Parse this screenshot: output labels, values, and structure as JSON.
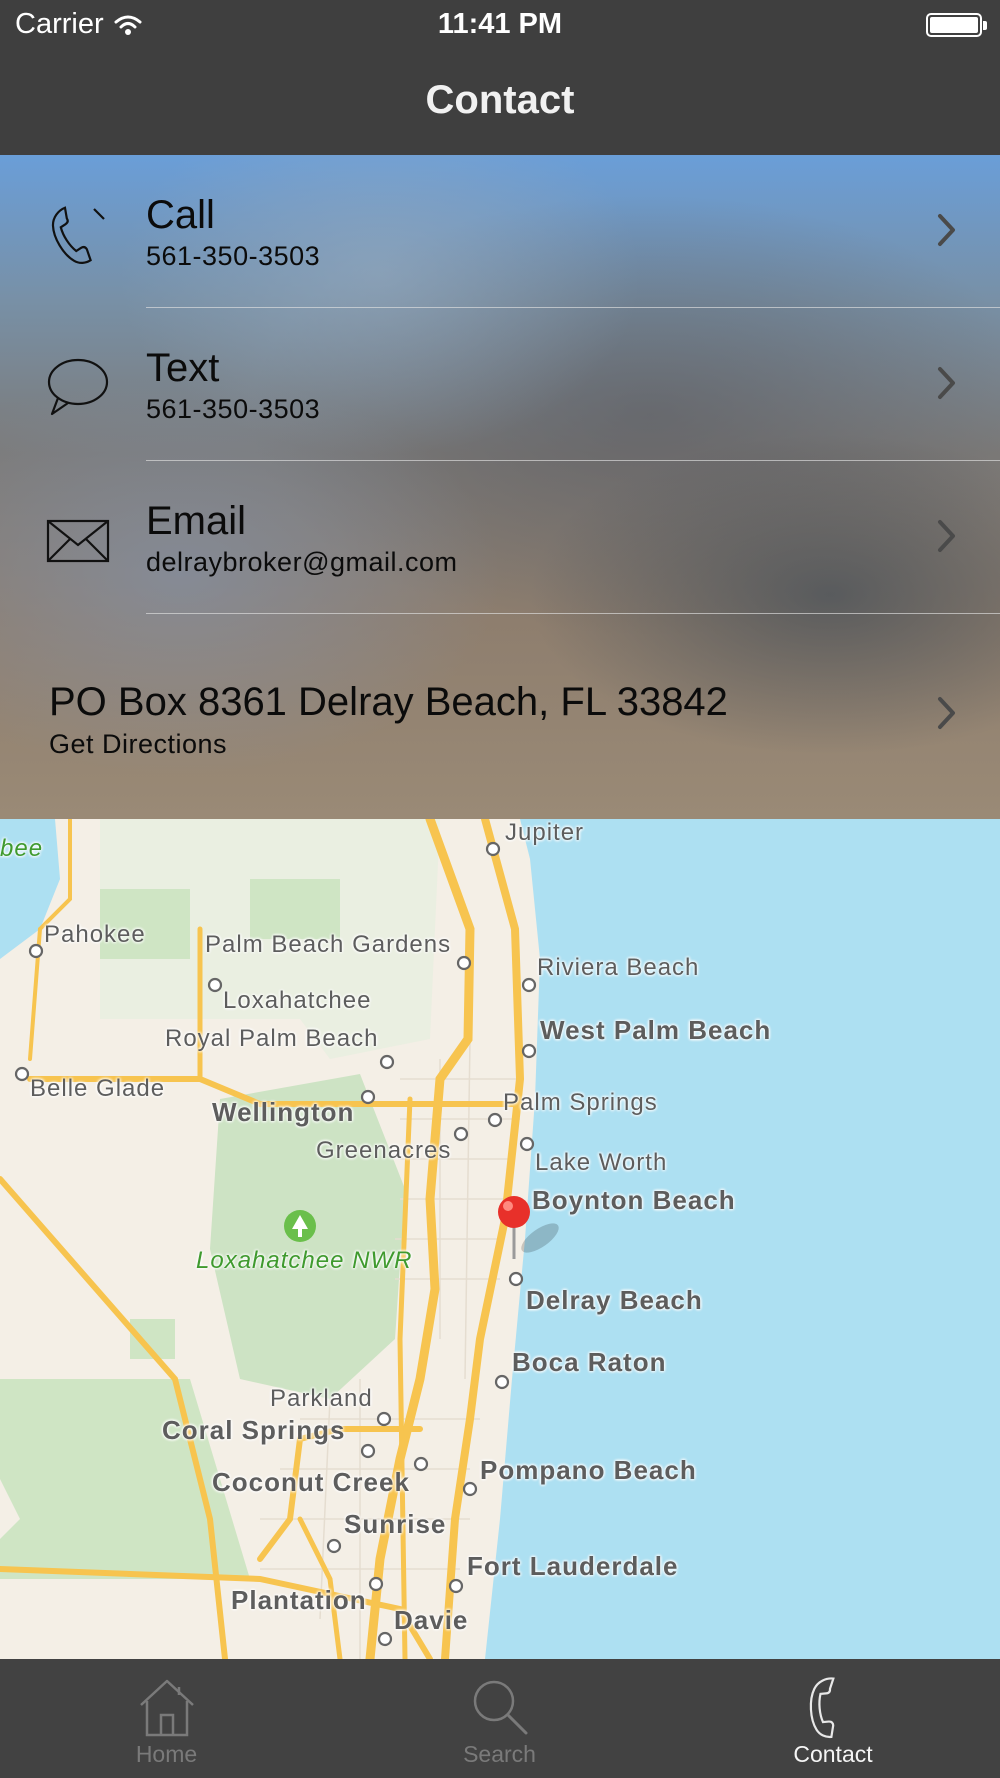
{
  "status_bar": {
    "carrier": "Carrier",
    "time": "11:41 PM"
  },
  "nav": {
    "title": "Contact"
  },
  "contact": {
    "rows": [
      {
        "title": "Call",
        "subtitle": "561-350-3503",
        "icon": "phone-icon"
      },
      {
        "title": "Text",
        "subtitle": "561-350-3503",
        "icon": "chat-bubble-icon"
      },
      {
        "title": "Email",
        "subtitle": "delraybroker@gmail.com",
        "icon": "envelope-icon"
      }
    ],
    "address": {
      "title": "PO Box 8361 Delray Beach, FL 33842",
      "subtitle": "Get Directions"
    }
  },
  "map": {
    "labels": {
      "jupiter": "Jupiter",
      "bee": "bee",
      "pahokee": "Pahokee",
      "palm_beach_gardens": "Palm Beach Gardens",
      "riviera_beach": "Riviera Beach",
      "loxahatchee": "Loxahatchee",
      "west_palm_beach": "West Palm Beach",
      "royal_palm_beach": "Royal Palm Beach",
      "belle_glade": "Belle Glade",
      "palm_springs": "Palm Springs",
      "wellington": "Wellington",
      "greenacres": "Greenacres",
      "lake_worth": "Lake Worth",
      "boynton_beach": "Boynton Beach",
      "loxahatchee_nwr": "Loxahatchee NWR",
      "delray_beach": "Delray Beach",
      "boca_raton": "Boca Raton",
      "parkland": "Parkland",
      "coral_springs": "Coral Springs",
      "pompano_beach": "Pompano Beach",
      "coconut_creek": "Coconut Creek",
      "sunrise": "Sunrise",
      "fort_lauderdale": "Fort Lauderdale",
      "plantation": "Plantation",
      "davie": "Davie"
    },
    "pin_color": "#e8302a"
  },
  "tabs": [
    {
      "label": "Home",
      "icon": "house-icon"
    },
    {
      "label": "Search",
      "icon": "magnifier-icon"
    },
    {
      "label": "Contact",
      "icon": "phone-icon",
      "active": true
    }
  ]
}
